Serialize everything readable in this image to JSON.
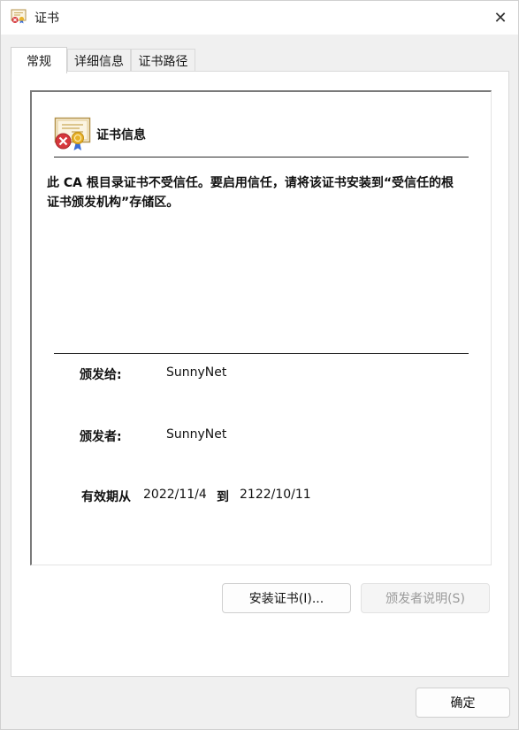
{
  "window": {
    "title": "证书",
    "close_glyph": "✕"
  },
  "tabs": [
    {
      "label": "常规",
      "active": true
    },
    {
      "label": "详细信息",
      "active": false
    },
    {
      "label": "证书路径",
      "active": false
    }
  ],
  "cert_info": {
    "title": "证书信息",
    "icon": "certificate-error-icon",
    "warning": "此 CA 根目录证书不受信任。要启用信任，请将该证书安装到“受信任的根证书颁发机构”存储区。",
    "issued_to_label": "颁发给:",
    "issued_to": "SunnyNet",
    "issued_by_label": "颁发者:",
    "issued_by": "SunnyNet",
    "valid_from_label": "有效期从",
    "valid_from": "2022/11/4",
    "valid_to_label": "到",
    "valid_to": "2122/10/11"
  },
  "buttons": {
    "install": "安装证书(I)...",
    "issuer_statement": "颁发者说明(S)",
    "ok": "确定"
  },
  "colors": {
    "error_red": "#d6373c",
    "ribbon_blue": "#3a6ed8",
    "seal_gold": "#e8b22a"
  }
}
